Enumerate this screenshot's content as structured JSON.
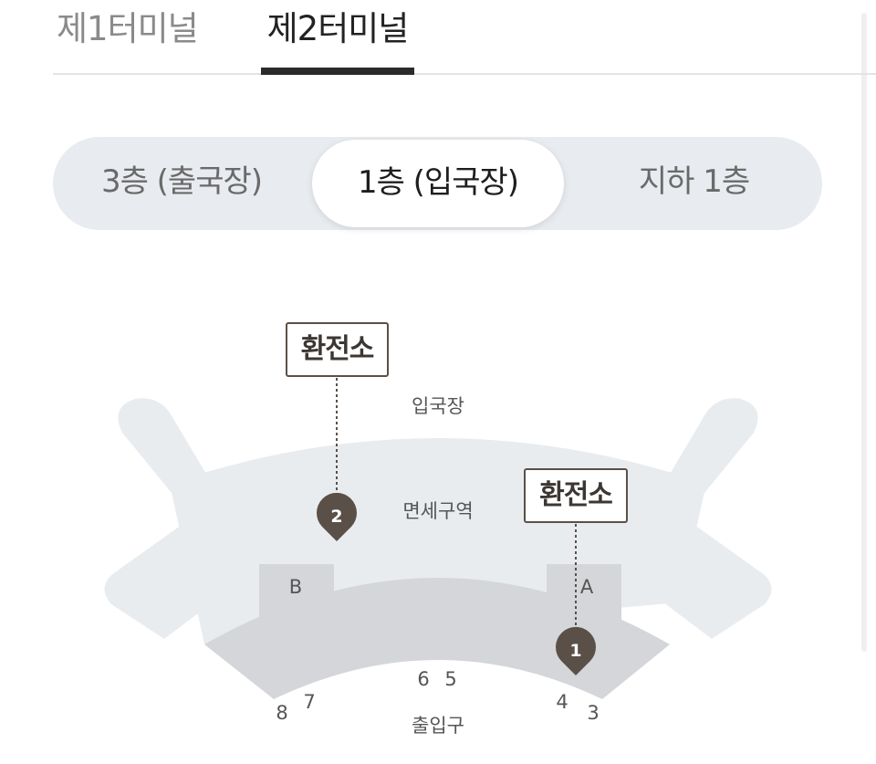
{
  "terminal_tabs": {
    "items": [
      {
        "label": "제1터미널",
        "selected": false
      },
      {
        "label": "제2터미널",
        "selected": true
      }
    ]
  },
  "floor_selector": {
    "items": [
      {
        "label": "3층 (출국장)",
        "selected": false
      },
      {
        "label": "1층 (입국장)",
        "selected": true
      },
      {
        "label": "지하 1층",
        "selected": false
      }
    ]
  },
  "map": {
    "area_labels": {
      "arrival_hall": "입국장",
      "duty_free": "면세구역",
      "entrance": "출입구"
    },
    "zones": {
      "a": "A",
      "b": "B"
    },
    "gates": {
      "g8": "8",
      "g7": "7",
      "g6": "6",
      "g5": "5",
      "g4": "4",
      "g3": "3"
    },
    "exchange_points": [
      {
        "number": "1",
        "label": "환전소"
      },
      {
        "number": "2",
        "label": "환전소"
      }
    ],
    "colors": {
      "floor_light": "#e9ecef",
      "floor_dark": "#d4d6d9",
      "marker": "#5a5048"
    }
  }
}
